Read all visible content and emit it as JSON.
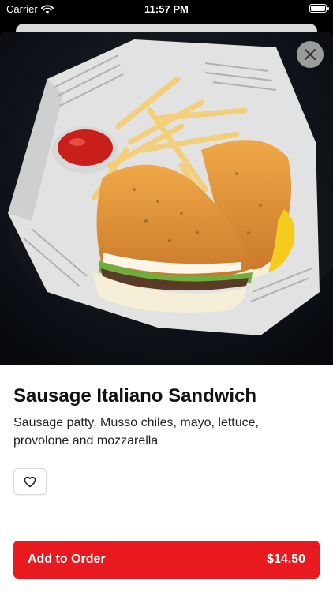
{
  "status_bar": {
    "carrier": "Carrier",
    "time": "11:57 PM"
  },
  "item": {
    "title": "Sausage Italiano Sandwich",
    "description": "Sausage patty, Musso chiles, mayo, lettuce, provolone and mozzarella",
    "image_label": "Sausage Italiano Sandwich with fries and ketchup"
  },
  "actions": {
    "add_label": "Add to Order",
    "price": "$14.50"
  },
  "colors": {
    "accent": "#e8191f"
  },
  "icons": {
    "close": "close-icon",
    "favorite": "heart-icon",
    "wifi": "wifi-icon",
    "battery": "battery-icon"
  }
}
